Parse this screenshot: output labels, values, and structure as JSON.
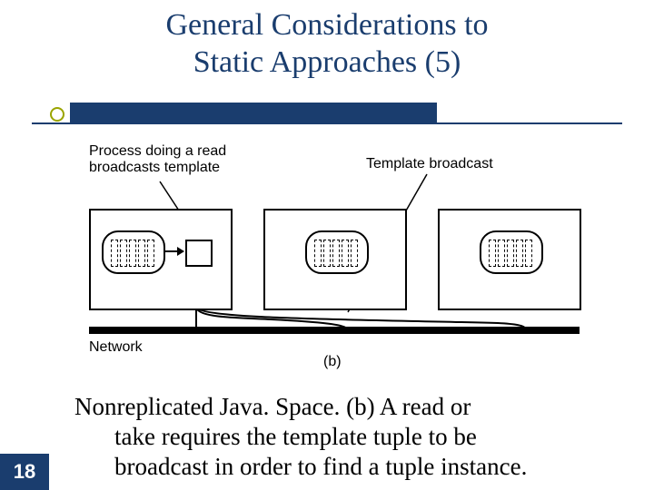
{
  "title_line1": "General Considerations to",
  "title_line2": "Static Approaches (5)",
  "diagram": {
    "label_process": "Process doing a read\nbroadcasts template",
    "label_template_broadcast": "Template broadcast",
    "label_network": "Network",
    "sublabel": "(b)"
  },
  "caption": {
    "line1": "Nonreplicated Java. Space. (b) A read or",
    "line2": "take requires the template tuple to be",
    "line3": "broadcast in order to find a tuple instance."
  },
  "page_number": "18"
}
